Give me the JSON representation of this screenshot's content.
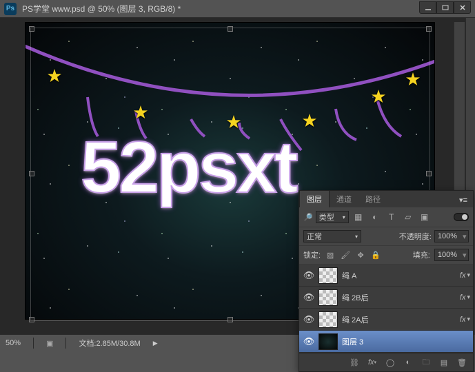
{
  "titlebar": {
    "app_icon": "Ps",
    "title": "PS学堂 www.psd @ 50% (图层 3, RGB/8) *"
  },
  "canvas": {
    "text": "52psxt"
  },
  "statusbar": {
    "zoom": "50%",
    "doc_label": "文档:",
    "doc_value": "2.85M/30.8M"
  },
  "panel": {
    "tabs": [
      "图层",
      "通道",
      "路径"
    ],
    "active_tab": 0,
    "filter_kind_label": "类型",
    "blend_mode": "正常",
    "opacity_label": "不透明度:",
    "opacity_value": "100%",
    "lock_label": "锁定:",
    "fill_label": "填充:",
    "fill_value": "100%",
    "layers": [
      {
        "name": "绳 A",
        "visible": true,
        "fx": true,
        "selected": false,
        "thumb": "checker"
      },
      {
        "name": "绳 2B后",
        "visible": true,
        "fx": true,
        "selected": false,
        "thumb": "checker"
      },
      {
        "name": "绳 2A后",
        "visible": true,
        "fx": true,
        "selected": false,
        "thumb": "checker"
      },
      {
        "name": "图层 3",
        "visible": true,
        "fx": false,
        "selected": true,
        "thumb": "dark"
      }
    ]
  }
}
